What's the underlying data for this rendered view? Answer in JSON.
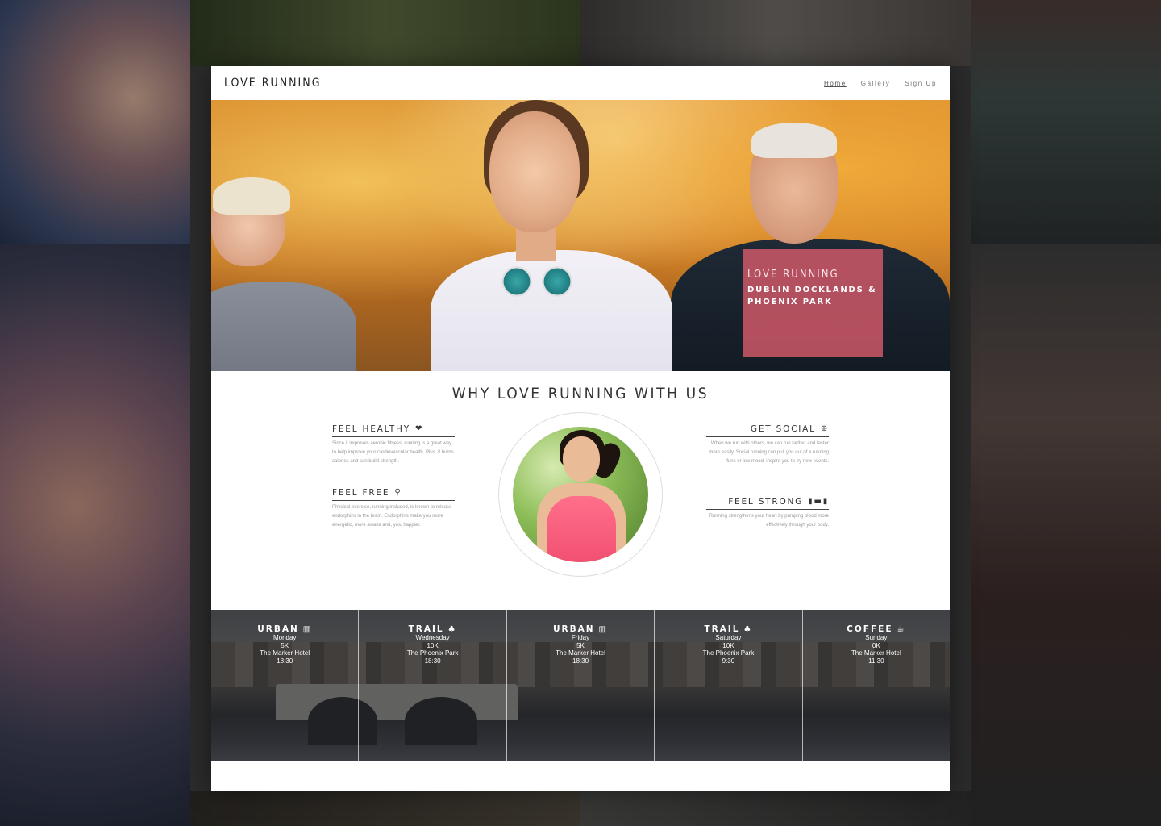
{
  "nav": {
    "brand": "LOVE RUNNING",
    "links": [
      "Home",
      "Gallery",
      "Sign Up"
    ]
  },
  "hero": {
    "title": "LOVE RUNNING",
    "subtitle_line1": "DUBLIN DOCKLANDS &",
    "subtitle_line2": "PHOENIX PARK",
    "box_color": "#d65a6a"
  },
  "why": {
    "title": "WHY LOVE RUNNING WITH US",
    "features": [
      {
        "heading": "FEEL HEALTHY",
        "icon": "heartbeat-icon",
        "text": "Since it improves aerobic fitness, running is a great way to help improve your cardiovascular health. Plus, it burns calories and can build strength."
      },
      {
        "heading": "FEEL FREE",
        "icon": "lightbulb-icon",
        "text": "Physical exercise, running included, is known to release endorphins in the brain. Endorphins make you more energetic, more awake and, yes, happier."
      },
      {
        "heading": "GET SOCIAL",
        "icon": "globe-icon",
        "text": "When we run with others, we can run farther and faster more easily. Social running can pull you out of a running funk or low mood, inspire you to try new events."
      },
      {
        "heading": "FEEL STRONG",
        "icon": "dumbbell-icon",
        "text": "Running strengthens your heart by pumping blood more effectively through your body."
      }
    ]
  },
  "schedule": [
    {
      "type": "URBAN",
      "icon": "city-icon",
      "day": "Monday",
      "distance": "5K",
      "location": "The Marker Hotel",
      "time": "18:30"
    },
    {
      "type": "TRAIL",
      "icon": "tree-icon",
      "day": "Wednesday",
      "distance": "10K",
      "location": "The Phoenix Park",
      "time": "18:30"
    },
    {
      "type": "URBAN",
      "icon": "city-icon",
      "day": "Friday",
      "distance": "5K",
      "location": "The Marker Hotel",
      "time": "18:30"
    },
    {
      "type": "TRAIL",
      "icon": "tree-icon",
      "day": "Saturday",
      "distance": "10K",
      "location": "The Phoenix Park",
      "time": "9:30"
    },
    {
      "type": "COFFEE",
      "icon": "coffee-icon",
      "day": "Sunday",
      "distance": "0K",
      "location": "The Marker Hotel",
      "time": "11:30"
    }
  ]
}
